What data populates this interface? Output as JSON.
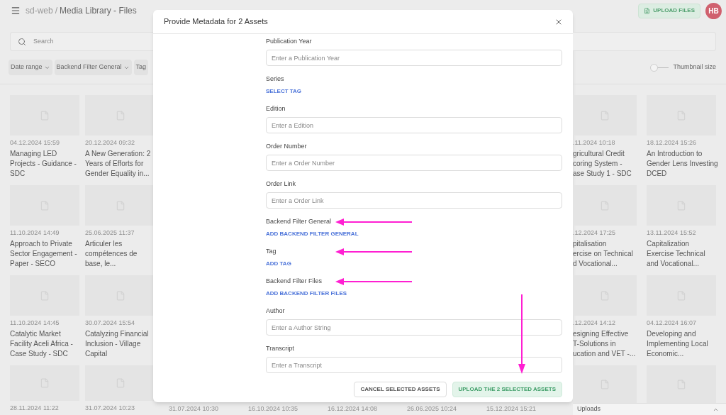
{
  "header": {
    "app": "sd-web",
    "separator": "/",
    "page": "Media Library - Files",
    "upload_button": "UPLOAD FILES",
    "avatar": "HB"
  },
  "search": {
    "placeholder": "Search"
  },
  "filters": [
    {
      "label": "Date range",
      "dropdown": true
    },
    {
      "label": "Backend Filter General",
      "dropdown": true
    },
    {
      "label": "Tag",
      "dropdown": false
    }
  ],
  "thumbnail_size": {
    "label": "Thumbnail size",
    "level": 0
  },
  "cards_left": [
    [
      {
        "date": "04.12.2024 15:59",
        "title_lines": [
          "Managing LED",
          "Projects - Guidance -",
          "SDC"
        ]
      },
      {
        "date": "20.12.2024 09:32",
        "title_lines": [
          "A New Generation: 2",
          "Years of Efforts for",
          "Gender Equality in..."
        ]
      }
    ],
    [
      {
        "date": "11.10.2024 14:49",
        "title_lines": [
          "Approach to Private",
          "Sector Engagement -",
          "Paper - SECO"
        ]
      },
      {
        "date": "25.06.2025 11:37",
        "title_lines": [
          "Articuler les",
          "compétences de",
          "base, le..."
        ]
      }
    ],
    [
      {
        "date": "11.10.2024 14:45",
        "title_lines": [
          "Catalytic Market",
          "Facility Aceli Africa -",
          "Case Study - SDC"
        ]
      },
      {
        "date": "30.07.2024 15:54",
        "title_lines": [
          "Catalyzing Financial",
          "Inclusion - Village",
          "Capital"
        ]
      }
    ],
    [
      {
        "date": "28.11.2024 11:22"
      },
      {
        "date": "31.07.2024 10:23"
      }
    ]
  ],
  "cards_right": [
    [
      {
        "date": ".11.2024 10:18",
        "title_lines": [
          "gricultural Credit",
          "coring System -",
          "ase Study 1 - SDC"
        ]
      },
      {
        "date": "18.12.2024 15:26",
        "title_lines": [
          "An Introduction to",
          "Gender Lens Investing",
          "DCED"
        ]
      }
    ],
    [
      {
        "date": ".12.2024 17:25",
        "title_lines": [
          "pitalisation",
          "ercise on Technical",
          "d Vocational..."
        ]
      },
      {
        "date": "13.11.2024 15:52",
        "title_lines": [
          "Capitalization",
          "Exercise Technical",
          "and Vocational..."
        ]
      }
    ],
    [
      {
        "date": ".12.2024 14:12",
        "title_lines": [
          "esigning Effective",
          "T-Solutions in",
          "ucation and VET -..."
        ]
      },
      {
        "date": "04.12.2024 16:07",
        "title_lines": [
          "Developing and",
          "Implementing Local",
          "Economic..."
        ]
      }
    ]
  ],
  "bottom_dates": [
    "31.07.2024 10:30",
    "16.10.2024 10:35",
    "16.12.2024 14:08",
    "26.06.2025 10:24",
    "15.12.2024 15:21"
  ],
  "modal": {
    "title": "Provide Metadata for 2 Assets",
    "fields": [
      {
        "kind": "input",
        "label": "Publication Year",
        "placeholder": "Enter a Publication Year",
        "highlighted": false
      },
      {
        "kind": "link",
        "label": "Series",
        "action": "SELECT TAG",
        "highlighted": false
      },
      {
        "kind": "input",
        "label": "Edition",
        "placeholder": "Enter a Edition",
        "highlighted": false
      },
      {
        "kind": "input",
        "label": "Order Number",
        "placeholder": "Enter a Order Number",
        "highlighted": false
      },
      {
        "kind": "input",
        "label": "Order Link",
        "placeholder": "Enter a Order Link",
        "highlighted": false
      },
      {
        "kind": "link",
        "label": "Backend Filter General",
        "action": "ADD BACKEND FILTER GENERAL",
        "highlighted": true
      },
      {
        "kind": "link",
        "label": "Tag",
        "action": "ADD TAG",
        "highlighted": true
      },
      {
        "kind": "link",
        "label": "Backend Filter Files",
        "action": "ADD BACKEND FILTER FILES",
        "highlighted": true
      },
      {
        "kind": "input",
        "label": "Author",
        "placeholder": "Enter a Author String",
        "highlighted": false
      },
      {
        "kind": "input",
        "label": "Transcript",
        "placeholder": "Enter a Transcript",
        "highlighted": false
      }
    ],
    "cancel_button": "CANCEL SELECTED ASSETS",
    "upload_button": {
      "label": "UPLOAD THE 2 SELECTED ASSETS",
      "highlighted": true
    }
  },
  "uploads_bar": {
    "label": "Uploads"
  }
}
